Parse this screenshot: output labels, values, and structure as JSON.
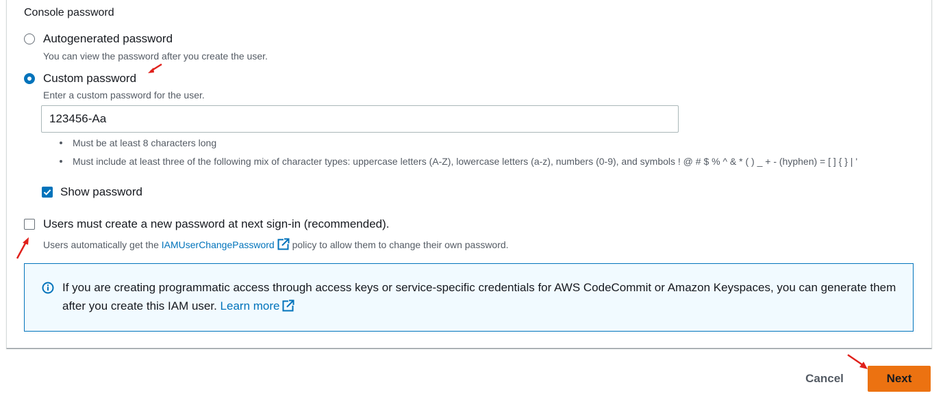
{
  "section": {
    "label": "Console password"
  },
  "password_options": [
    {
      "label": "Autogenerated password",
      "hint": "You can view the password after you create the user.",
      "selected": false
    },
    {
      "label": "Custom password",
      "hint": "Enter a custom password for the user.",
      "selected": true
    }
  ],
  "password_field": {
    "value": "123456-Aa"
  },
  "rules": [
    "Must be at least 8 characters long",
    "Must include at least three of the following mix of character types: uppercase letters (A-Z), lowercase letters (a-z), numbers (0-9), and symbols ! @ # $ % ^ & * ( ) _ + - (hyphen) = [ ] { } | '"
  ],
  "show_password": {
    "label": "Show password",
    "checked": true
  },
  "reset_required": {
    "label": "Users must create a new password at next sign-in (recommended).",
    "checked": false,
    "hint_before": "Users automatically get the ",
    "hint_link": "IAMUserChangePassword",
    "hint_after": " policy to allow them to change their own password."
  },
  "info_alert": {
    "text": "If you are creating programmatic access through access keys or service-specific credentials for AWS CodeCommit or Amazon Keyspaces, you can generate them after you create this IAM user. ",
    "link": "Learn more"
  },
  "footer": {
    "cancel_label": "Cancel",
    "next_label": "Next"
  },
  "colors": {
    "accent": "#0073bb",
    "primary_button": "#ec7211",
    "annotation_arrow": "#e0201b"
  },
  "icons": {
    "external_link": "external-link-icon",
    "info": "info-icon",
    "check": "checkmark-icon"
  }
}
